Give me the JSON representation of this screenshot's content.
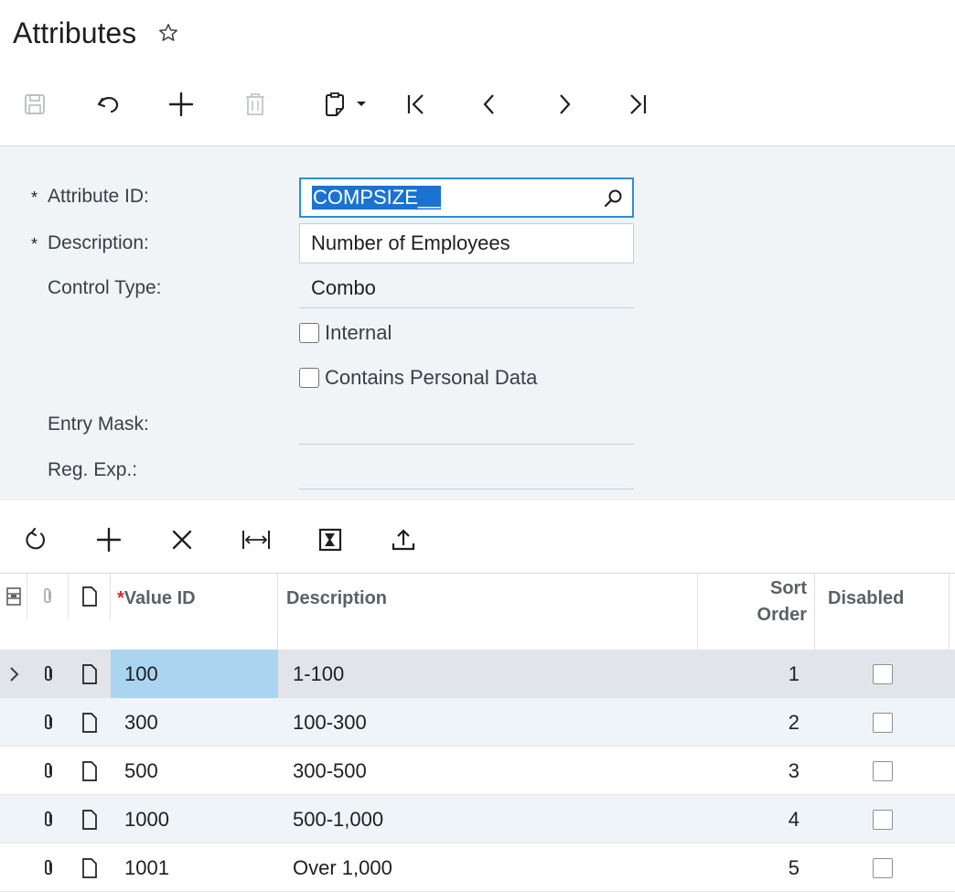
{
  "header": {
    "title": "Attributes"
  },
  "toolbar": {
    "buttons": [
      {
        "name": "save",
        "icon": "save-icon",
        "enabled": false
      },
      {
        "name": "cancel",
        "icon": "undo-icon",
        "enabled": true
      },
      {
        "name": "add",
        "icon": "plus-icon",
        "enabled": true
      },
      {
        "name": "delete",
        "icon": "trash-icon",
        "enabled": false
      },
      {
        "name": "copy-paste",
        "icon": "clipboard-icon",
        "enabled": true
      },
      {
        "name": "first",
        "icon": "first-record-icon",
        "enabled": true
      },
      {
        "name": "previous",
        "icon": "previous-icon",
        "enabled": true
      },
      {
        "name": "next",
        "icon": "next-icon",
        "enabled": true
      },
      {
        "name": "last",
        "icon": "last-record-icon",
        "enabled": true
      }
    ]
  },
  "form": {
    "attribute_id": {
      "label": "Attribute ID:",
      "value": "COMPSIZE__",
      "required": true
    },
    "description": {
      "label": "Description:",
      "value": "Number of Employees",
      "required": true
    },
    "control_type": {
      "label": "Control Type:",
      "value": "Combo"
    },
    "internal": {
      "label": "Internal",
      "checked": false
    },
    "personal_data": {
      "label": "Contains Personal Data",
      "checked": false
    },
    "entry_mask": {
      "label": "Entry Mask:",
      "value": ""
    },
    "reg_exp": {
      "label": "Reg. Exp.:",
      "value": ""
    },
    "required_marker": "*"
  },
  "grid_toolbar": {
    "buttons": [
      {
        "name": "refresh",
        "icon": "refresh-icon"
      },
      {
        "name": "add-row",
        "icon": "plus-icon"
      },
      {
        "name": "delete-row",
        "icon": "close-icon"
      },
      {
        "name": "fit-columns",
        "icon": "fit-width-icon"
      },
      {
        "name": "export-excel",
        "icon": "excel-icon"
      },
      {
        "name": "upload",
        "icon": "upload-icon"
      }
    ]
  },
  "grid": {
    "columns": {
      "value_id": "Value ID",
      "description": "Description",
      "sort_order_line1": "Sort",
      "sort_order_line2": "Order",
      "disabled": "Disabled",
      "required_marker": "*"
    },
    "rows": [
      {
        "value_id": "100",
        "description": "1-100",
        "sort_order": "1",
        "disabled": false
      },
      {
        "value_id": "300",
        "description": "100-300",
        "sort_order": "2",
        "disabled": false
      },
      {
        "value_id": "500",
        "description": "300-500",
        "sort_order": "3",
        "disabled": false
      },
      {
        "value_id": "1000",
        "description": "500-1,000",
        "sort_order": "4",
        "disabled": false
      },
      {
        "value_id": "1001",
        "description": "Over 1,000",
        "sort_order": "5",
        "disabled": false
      }
    ]
  },
  "colors": {
    "accent": "#2d8fd6",
    "selection": "#1a73d1",
    "active_cell": "#aad4f0",
    "form_bg": "#f1f4f6",
    "required": "#e0262b"
  }
}
